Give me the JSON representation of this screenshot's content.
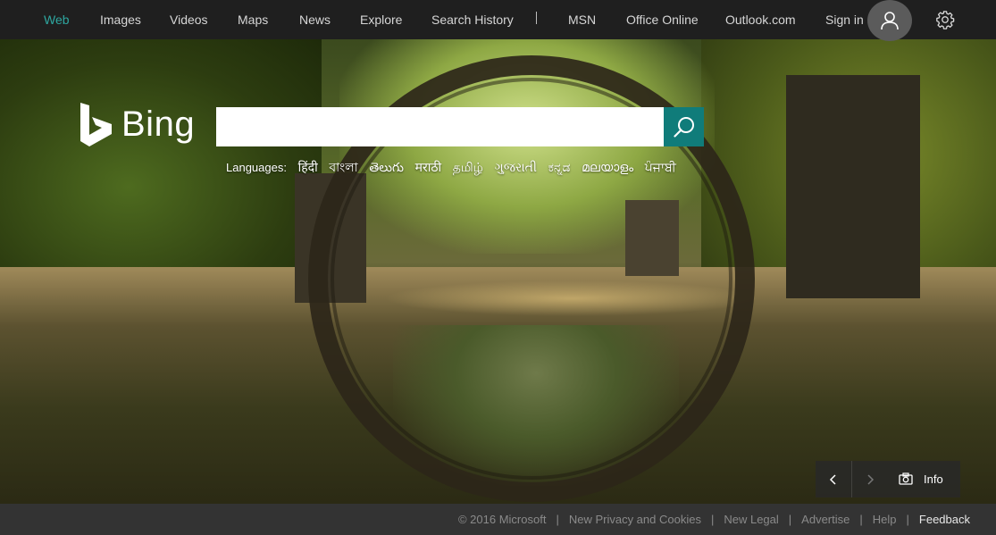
{
  "nav": {
    "items": [
      {
        "label": "Web",
        "active": true
      },
      {
        "label": "Images"
      },
      {
        "label": "Videos"
      },
      {
        "label": "Maps"
      },
      {
        "label": "News"
      },
      {
        "label": "Explore"
      },
      {
        "label": "Search History"
      },
      {
        "label": "MSN"
      },
      {
        "label": "Office Online"
      },
      {
        "label": "Outlook.com"
      }
    ],
    "sign_in": "Sign in",
    "icons": {
      "avatar": "user-icon",
      "settings": "gear-icon"
    }
  },
  "logo": {
    "text": "Bing"
  },
  "search": {
    "value": "",
    "placeholder": "",
    "button_icon": "search-icon"
  },
  "languages": {
    "label": "Languages:",
    "items": [
      "हिंदी",
      "বাংলা",
      "తెలుగు",
      "मराठी",
      "தமிழ்",
      "ગુજરાતી",
      "ಕನ್ನಡ",
      "മലയാളം",
      "ਪੰਜਾਬੀ"
    ]
  },
  "info_box": {
    "prev_icon": "chevron-left-icon",
    "next_icon": "chevron-right-icon",
    "camera_icon": "camera-icon",
    "label": "Info"
  },
  "footer": {
    "copyright": "© 2016 Microsoft",
    "links": [
      "New Privacy and Cookies",
      "New Legal",
      "Advertise",
      "Help"
    ],
    "feedback": "Feedback"
  },
  "colors": {
    "accent": "#2ea7a0",
    "search_button": "#107c7a",
    "topbar": "#1e1e1e",
    "footer": "#333333"
  }
}
